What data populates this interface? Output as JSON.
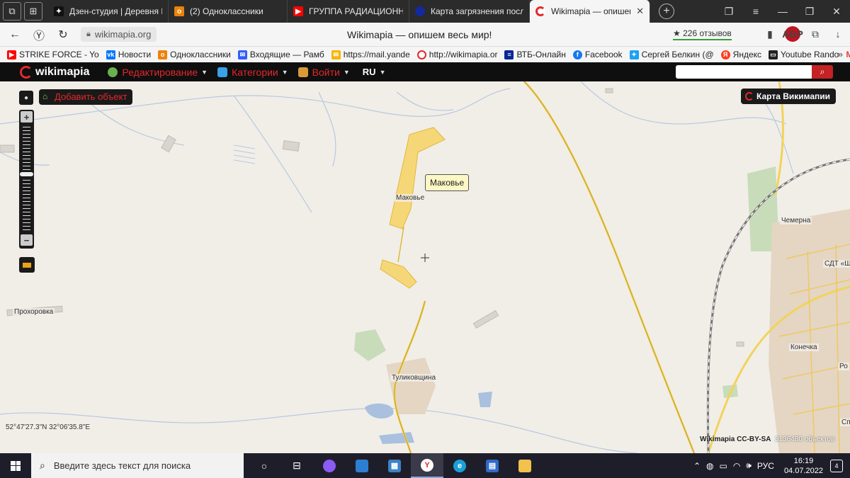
{
  "tabs": [
    {
      "label": "Дзен-студия | Деревня Кс",
      "fav_color": "#111111",
      "fav_icon": "star-icon"
    },
    {
      "label": "(2) Одноклассники",
      "fav_color": "#ee8208",
      "fav_icon": "odnoklassniki-icon"
    },
    {
      "label": "ГРУППА РАДИАЦИОННО",
      "fav_color": "#ff0000",
      "fav_icon": "youtube-icon"
    },
    {
      "label": "Карта загрязнения после",
      "fav_color": "#1428a0",
      "fav_icon": "globe-icon"
    },
    {
      "label": "Wikimapia — опишем",
      "fav_color": "#e3282c",
      "fav_icon": "wikimapia-icon",
      "active": true
    }
  ],
  "address": {
    "url": "wikimapia.org",
    "page_title": "Wikimapia — опишем весь мир!",
    "reviews": "★ 226 отзывов",
    "abp_label": "ABP"
  },
  "bookmarks": [
    {
      "label": "STRIKE FORCE - Yo",
      "color": "#ff0000"
    },
    {
      "label": "Новости",
      "color": "#0077ff",
      "glyph": "vk"
    },
    {
      "label": "Одноклассники",
      "color": "#ee8208"
    },
    {
      "label": "Входящие — Рамб",
      "color": "#315efb"
    },
    {
      "label": "https://mail.yande",
      "color": "#f7b500"
    },
    {
      "label": "http://wikimapia.or",
      "color": "#e3282c"
    },
    {
      "label": "ВТБ-Онлайн",
      "color": "#0a2896"
    },
    {
      "label": "Facebook",
      "color": "#1877f2",
      "glyph": "f"
    },
    {
      "label": "Сергей Белкин (@",
      "color": "#1da1f2"
    },
    {
      "label": "Яндекс",
      "color": "#fc3f1d",
      "glyph": "Я"
    },
    {
      "label": "Youtube Rando",
      "color": "#222222"
    },
    {
      "label": "M",
      "color": "#ea4335"
    }
  ],
  "wikimapia": {
    "logo": "wikimapia",
    "menu": [
      {
        "label": "Редактирование",
        "icon_color": "#6ab04c"
      },
      {
        "label": "Категории",
        "icon_color": "#3aa0e8"
      },
      {
        "label": "Войти",
        "icon_color": "#d89b3a"
      }
    ],
    "lang": "RU",
    "search_placeholder": ""
  },
  "map": {
    "add_object": "Добавить объект",
    "map_type": "Карта Викимапии",
    "popup": "Маковье",
    "labels": {
      "makovye": "Маковье",
      "prokhorovka": "Прохоровка",
      "tulukovshchina": "Туликовщина",
      "chemerna": "Чемерна",
      "sdt": "СДТ «Ш",
      "konechka": "Конечка",
      "ro": "Ро",
      "sh": "Сп"
    },
    "coords": "52°47'27.3\"N 32°06'35.8\"E",
    "license": "Wikimapia CC-BY-SA",
    "object_count": "3136480 объектов"
  },
  "taskbar": {
    "search_placeholder": "Введите здесь текст для поиска",
    "lang": "РУС",
    "time": "16:19",
    "date": "04.07.2022",
    "notifications": "4"
  }
}
